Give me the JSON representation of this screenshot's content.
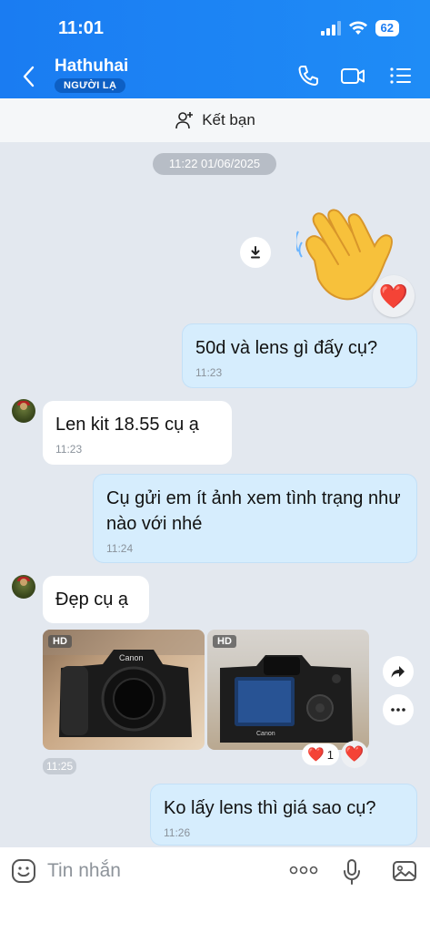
{
  "status_bar": {
    "time": "11:01",
    "battery": "62"
  },
  "header": {
    "contact_name": "Hathuhai",
    "badge": "NGƯỜI LẠ",
    "icons": [
      "back-icon",
      "phone-icon",
      "video-icon",
      "menu-icon"
    ]
  },
  "add_friend": {
    "label": "Kết bạn"
  },
  "timestamp": "11:22 01/06/2025",
  "sticker": {
    "name": "waving-hand-sticker",
    "reaction": "❤️"
  },
  "messages": [
    {
      "direction": "out",
      "text": "50d và lens gì đấy cụ?",
      "time": "11:23"
    },
    {
      "direction": "in",
      "text": "Len kit 18.55 cụ ạ",
      "time": "11:23"
    },
    {
      "direction": "out",
      "text": "Cụ gửi em ít ảnh xem tình trạng như nào với nhé",
      "time": "11:24"
    },
    {
      "direction": "in",
      "text": "Đẹp cụ ạ"
    },
    {
      "direction": "out",
      "text": "Ko lấy lens thì giá sao cụ?",
      "time": "11:26"
    }
  ],
  "photos": {
    "items": [
      {
        "badge": "HD",
        "brand": "Canon"
      },
      {
        "badge": "HD",
        "brand": "Canon"
      }
    ],
    "time": "11:25",
    "reaction_count": "1"
  },
  "input": {
    "placeholder": "Tin nhắn"
  },
  "colors": {
    "header": "#1a7cf2",
    "outgoing_bubble": "#d6edfd",
    "background": "#e3e8ef",
    "heart": "#e8112d"
  }
}
